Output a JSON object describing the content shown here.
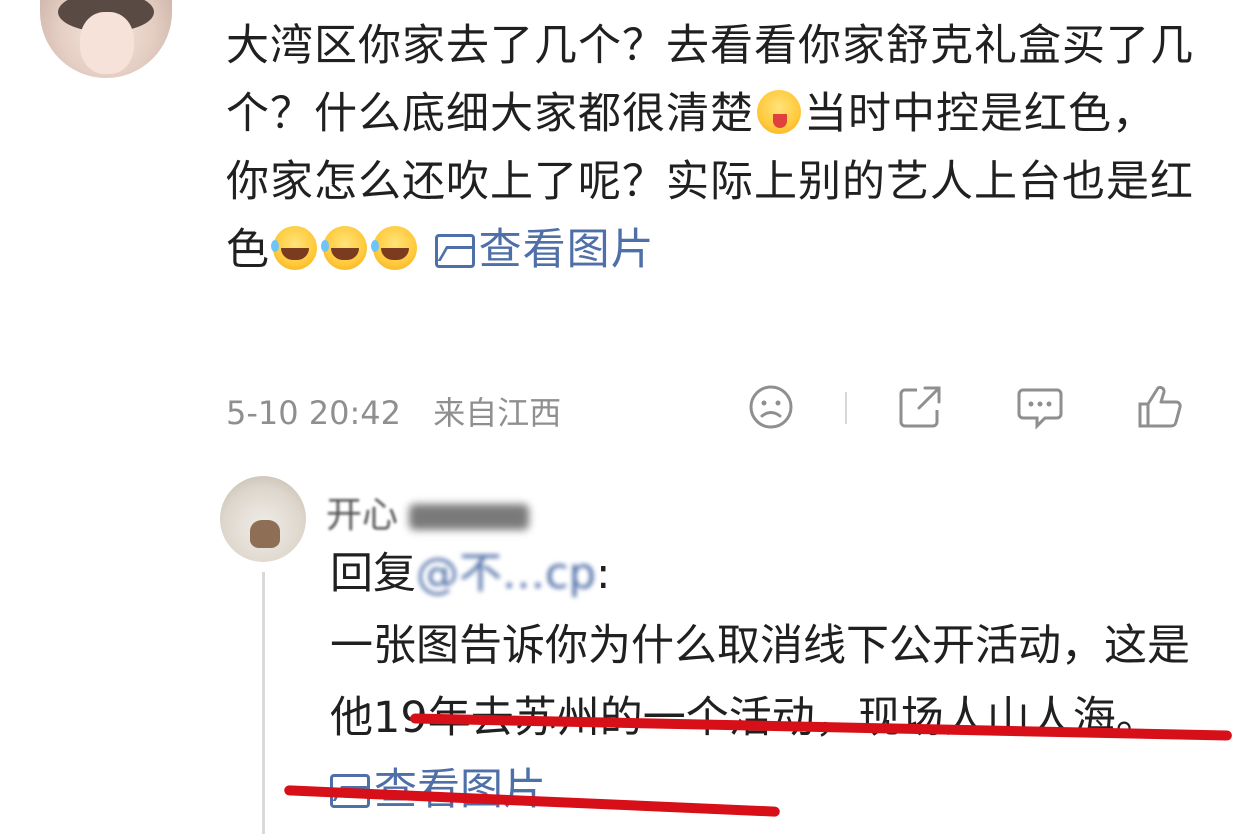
{
  "comment": {
    "segments": [
      "大湾区你家去了几个？去看看你家舒克礼盒买了几个？什么底细大家都很清楚",
      "当时中控是红色，你家怎么还吹上了呢？实际上别的艺人上台也是红色"
    ],
    "emoji_1": "wink-tongue-emoji",
    "emoji_laugh": "tears-of-joy-emoji",
    "view_image_label": "查看图片",
    "timestamp": "5-10 20:42",
    "location": "来自江西"
  },
  "actions": {
    "icons": [
      "sad-face-icon",
      "share-icon",
      "comment-icon",
      "like-icon"
    ]
  },
  "reply": {
    "author": "开心",
    "reply_prefix": "回复",
    "mention": "@不…cp",
    "colon": ":",
    "text_line": "一张图告诉你为什么取消线下公开活动，这是他19年去苏州的一个活动，现场人山人海。",
    "view_image_label": "查看图片"
  },
  "colors": {
    "link": "#4f6fa8",
    "meta": "#8f8f8f",
    "underline": "#d70f18"
  }
}
